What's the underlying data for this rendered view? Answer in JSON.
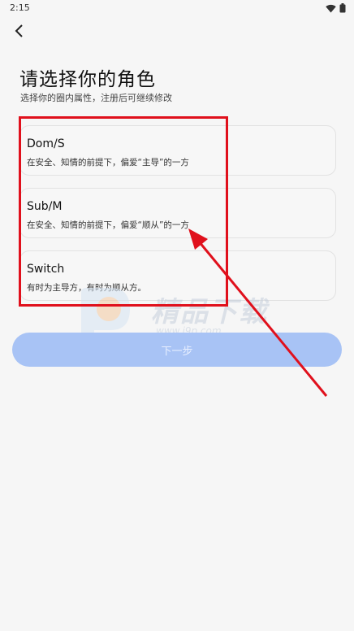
{
  "status_bar": {
    "time": "2:15"
  },
  "header": {
    "back_icon": "chevron-left-icon"
  },
  "title": "请选择你的角色",
  "subtitle": "选择你的圈内属性，注册后可继续修改",
  "roles": [
    {
      "name": "Dom/S",
      "desc": "在安全、知情的前提下，偏爱“主导”的一方"
    },
    {
      "name": "Sub/M",
      "desc": "在安全、知情的前提下，偏爱“顺从”的一方"
    },
    {
      "name": "Switch",
      "desc": "有时为主导方，有时为顺从方。"
    }
  ],
  "next_button": "下一步",
  "watermark": {
    "text": "精品下载",
    "url": "www.j9p.com"
  },
  "colors": {
    "accent": "#a8c3f5",
    "annotation": "#e0101c"
  }
}
